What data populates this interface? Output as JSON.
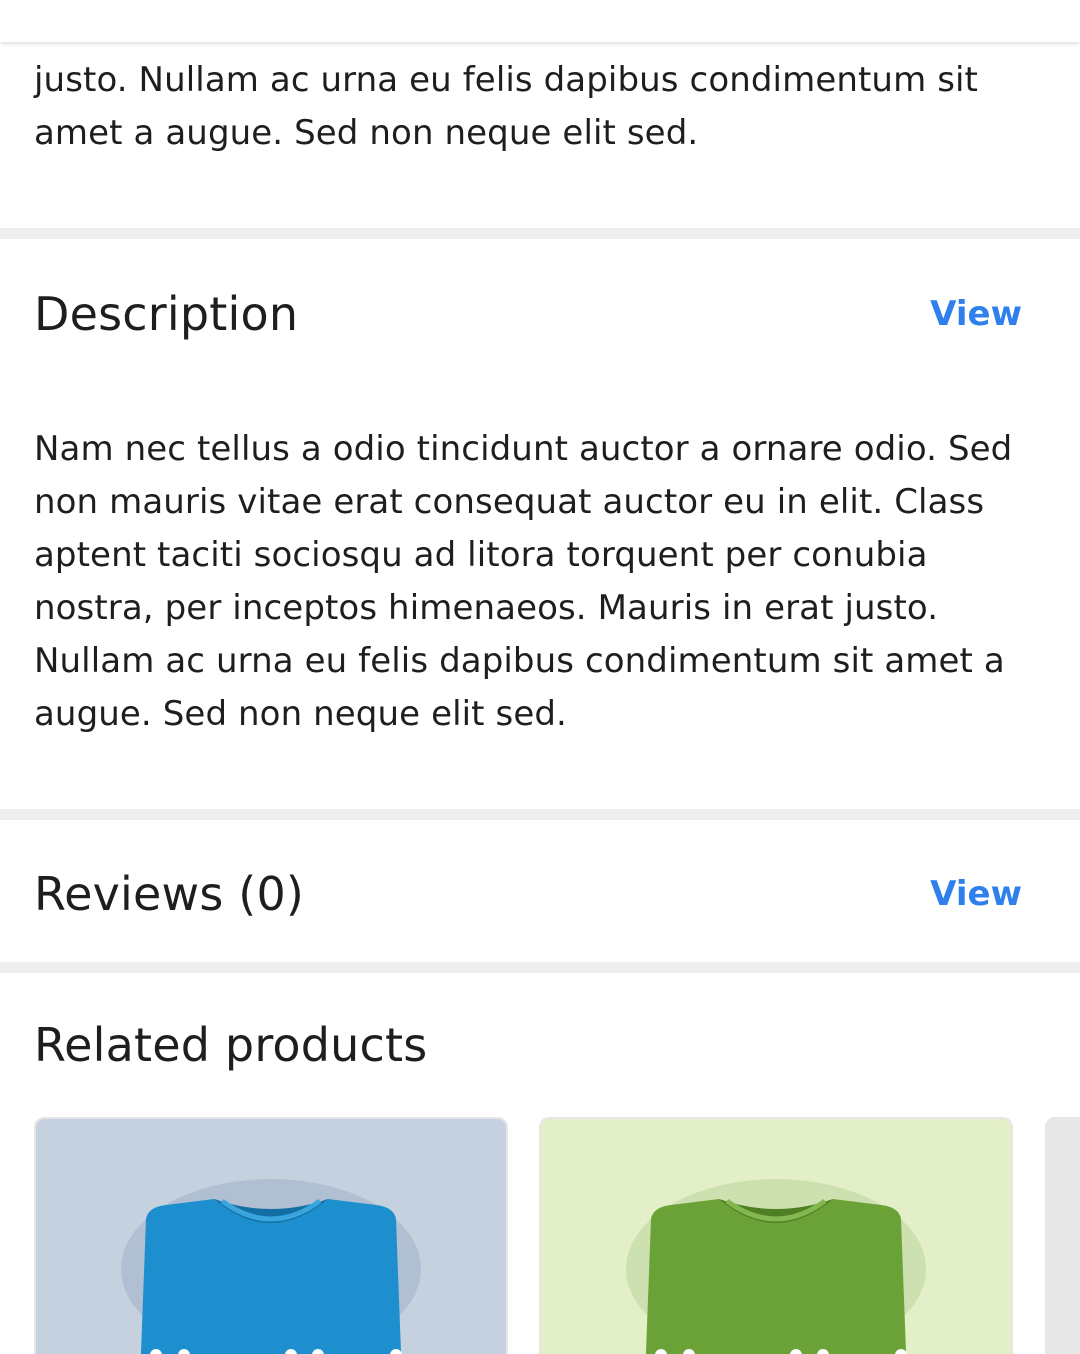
{
  "top_text": "justo. Nullam ac urna eu felis dapibus condimentum sit amet a augue. Sed non neque elit sed.",
  "description": {
    "title": "Description",
    "view_label": "View",
    "body": "Nam nec tellus a odio tincidunt auctor a ornare odio. Sed non mauris vitae erat consequat auctor eu in elit. Class aptent taciti sociosqu ad litora torquent per conubia nostra, per inceptos himenaeos. Mauris in erat justo. Nullam ac urna eu felis dapibus condimentum sit amet a augue. Sed non neque elit sed."
  },
  "reviews": {
    "title": "Reviews (0)",
    "view_label": "View"
  },
  "related": {
    "title": "Related products",
    "products": [
      {
        "image": "blue-tshirt",
        "bg_color": "#c5d1df",
        "shirt_color": "#1e8fce"
      },
      {
        "image": "green-tshirt",
        "bg_color": "#e3f0c7",
        "shirt_color": "#6ba238"
      }
    ]
  },
  "colors": {
    "accent": "#2f80ed",
    "divider": "#efefef"
  }
}
